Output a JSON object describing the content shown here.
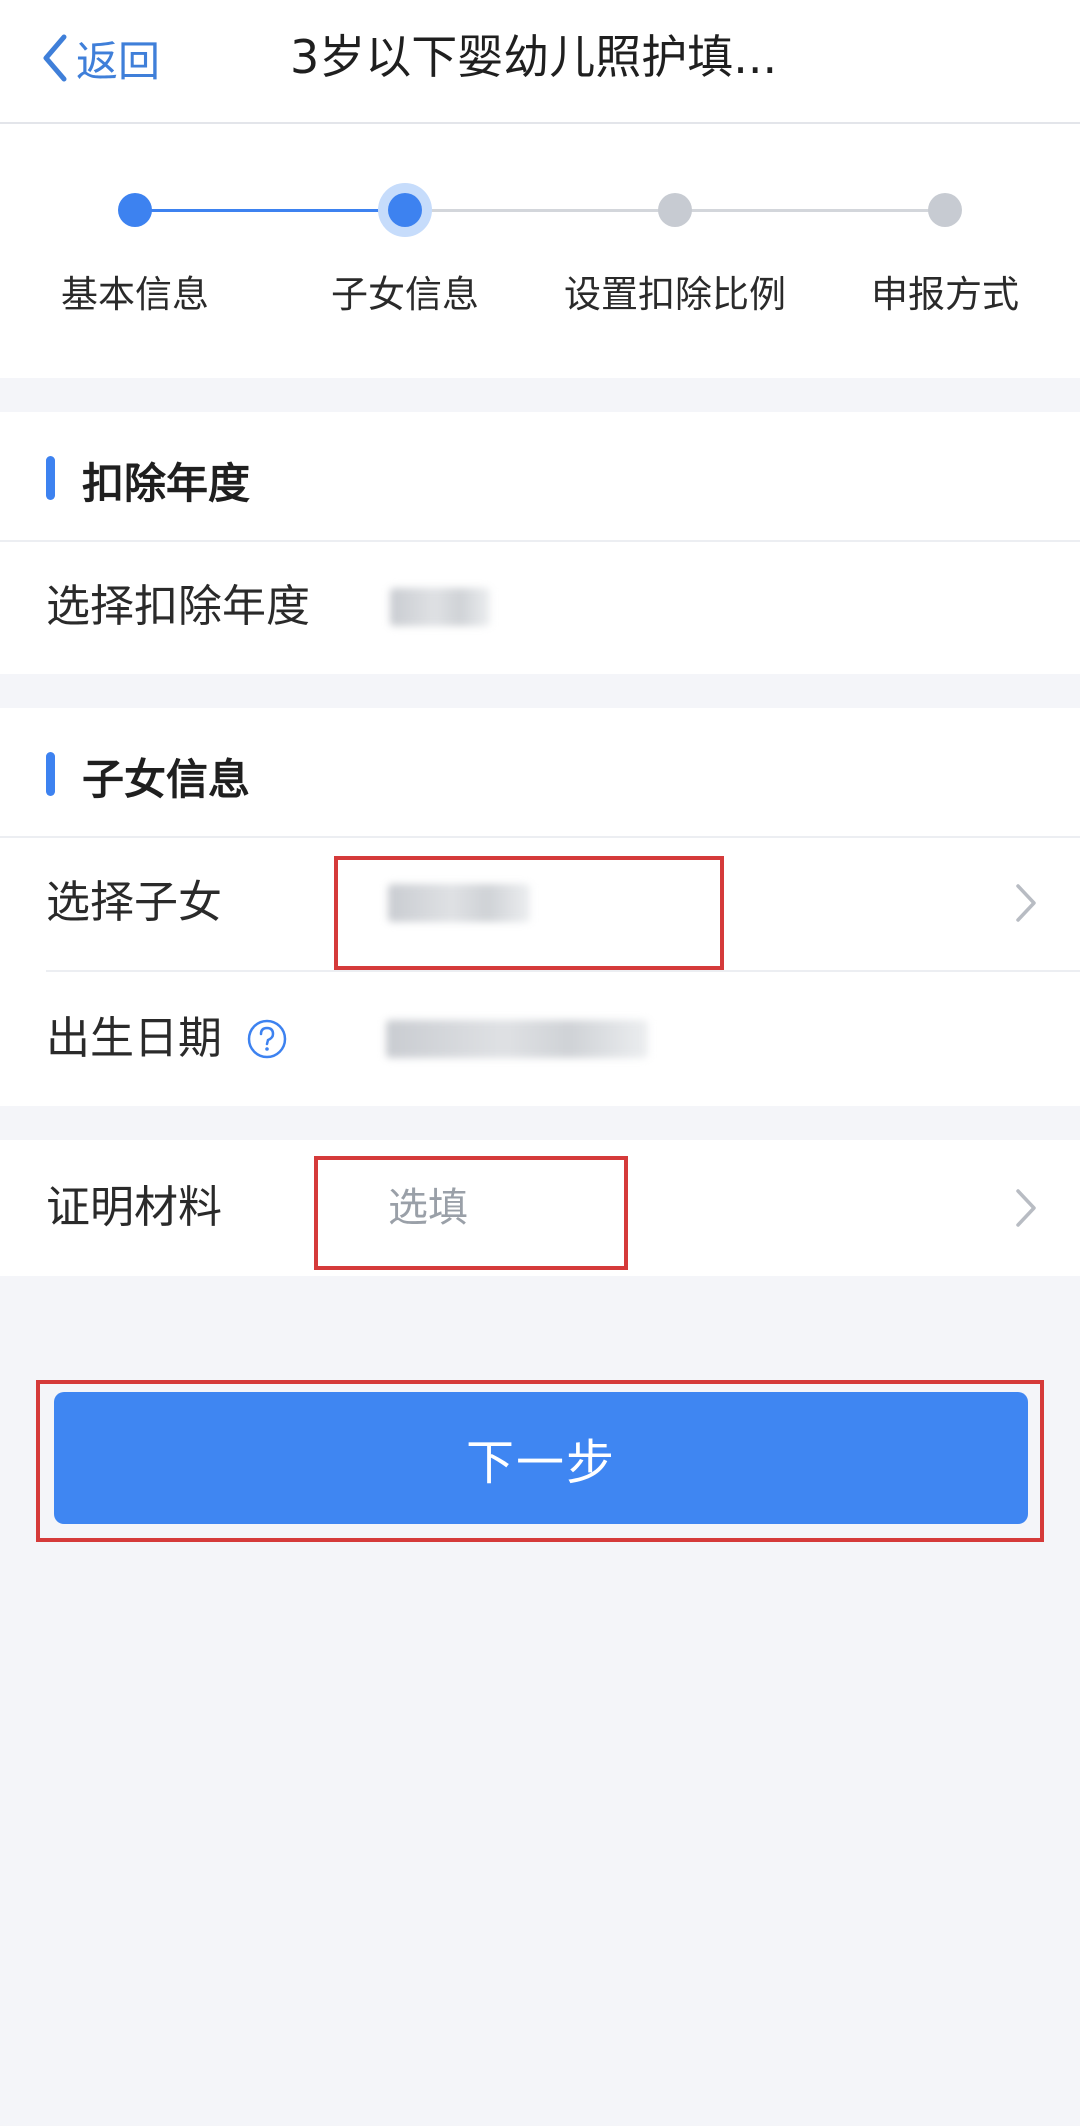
{
  "navbar": {
    "back_label": "返回",
    "title": "3岁以下婴幼儿照护填..."
  },
  "steps": [
    {
      "label": "基本信息",
      "state": "done"
    },
    {
      "label": "子女信息",
      "state": "current"
    },
    {
      "label": "设置扣除比例",
      "state": "todo"
    },
    {
      "label": "申报方式",
      "state": "todo"
    }
  ],
  "deduction_year": {
    "section_title": "扣除年度",
    "row_label": "选择扣除年度"
  },
  "child_info": {
    "section_title": "子女信息",
    "select_child_label": "选择子女",
    "birth_date_label": "出生日期"
  },
  "proof": {
    "label": "证明材料",
    "placeholder": "选填"
  },
  "next_button": "下一步",
  "colors": {
    "accent": "#3d82f0",
    "annotation": "#d53a3a",
    "background": "#f4f5f9"
  },
  "icons": {
    "back": "chevron-left-icon",
    "help": "question-circle-icon",
    "row_arrow": "chevron-right-icon"
  }
}
